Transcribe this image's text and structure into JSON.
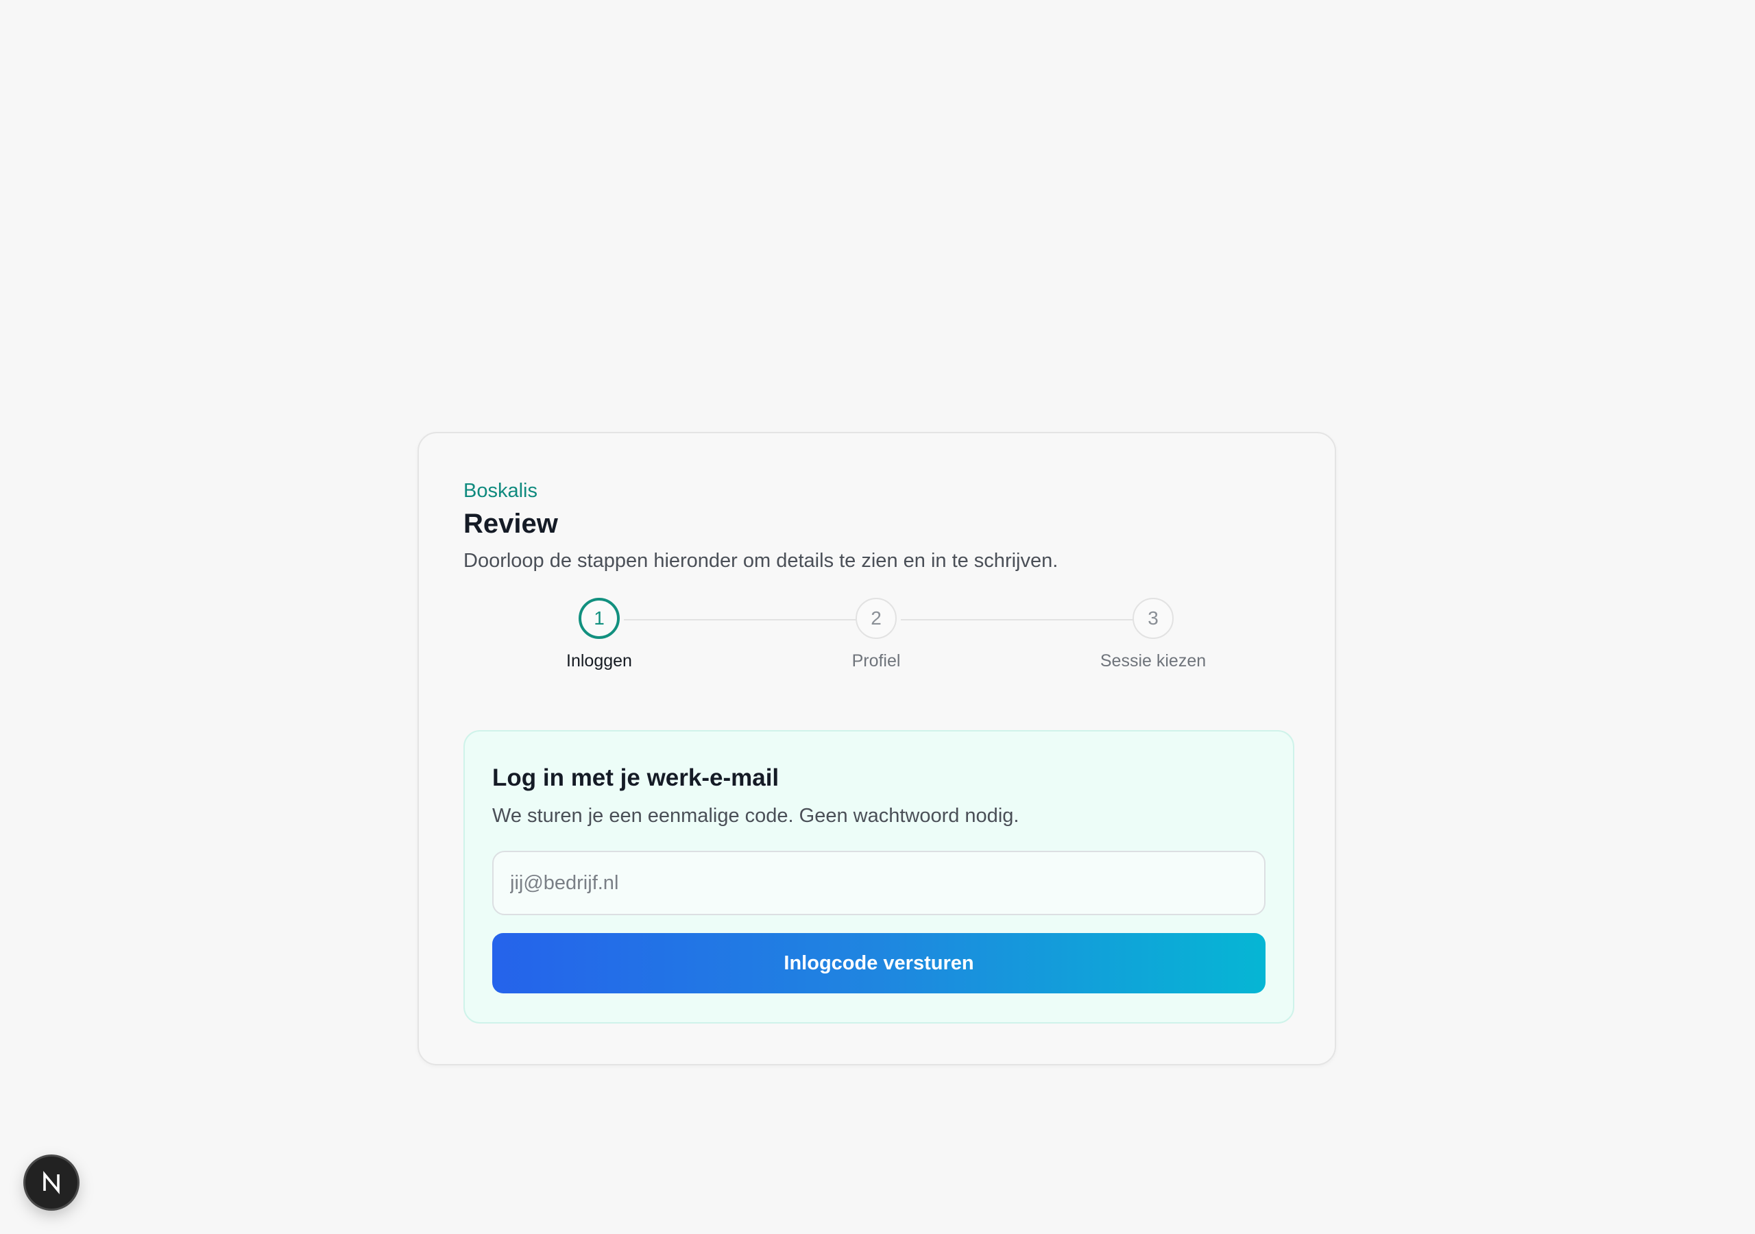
{
  "header": {
    "brand": "Boskalis",
    "title": "Review",
    "subtitle": "Doorloop de stappen hieronder om details te zien en in te schrijven."
  },
  "stepper": {
    "current_step": 1,
    "steps": [
      {
        "number": "1",
        "label": "Inloggen",
        "state": "active"
      },
      {
        "number": "2",
        "label": "Profiel",
        "state": "upcoming"
      },
      {
        "number": "3",
        "label": "Sessie kiezen",
        "state": "upcoming"
      }
    ]
  },
  "login": {
    "title": "Log in met je werk-e-mail",
    "description": "We sturen je een eenmalige code. Geen wachtwoord nodig.",
    "email_value": "",
    "email_placeholder": "jij@bedrijf.nl",
    "submit_label": "Inlogcode versturen"
  },
  "badge": {
    "icon": "nextjs-logo-icon"
  },
  "colors": {
    "accent": "#0f8a7e",
    "button_gradient_start": "#2563eb",
    "button_gradient_end": "#06b6d4",
    "panel_background": "#edfdf8"
  }
}
